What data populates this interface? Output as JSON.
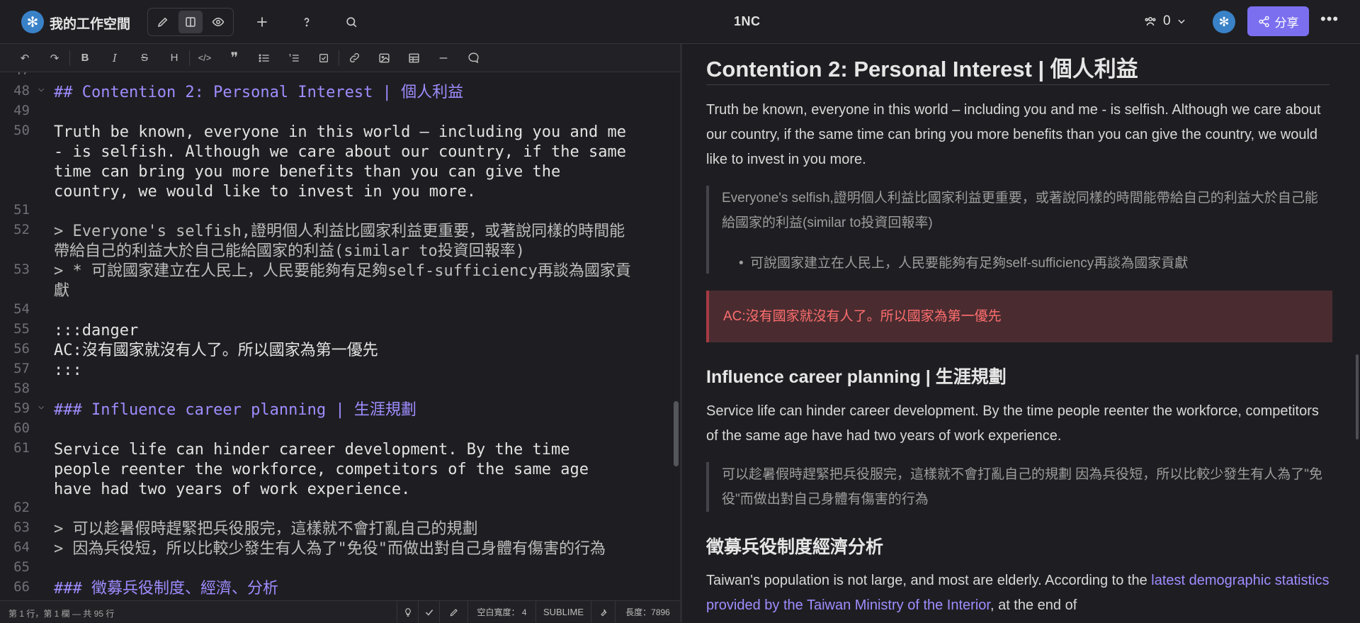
{
  "topbar": {
    "workspace": "我的工作空間",
    "title": "1NC",
    "online_count": "0",
    "share_label": "分享",
    "more_label": "•••"
  },
  "toolbar": {
    "heading_label": "H"
  },
  "editor": {
    "lines": [
      {
        "n": "48",
        "text": "## Contention 2: Personal Interest | 個人利益"
      },
      {
        "n": "49",
        "text": ""
      },
      {
        "n": "50",
        "text": "Truth be known, everyone in this world – including you and me\n- is selfish. Although we care about our country, if the same\ntime can bring you more benefits than you can give the\ncountry, we would like to invest in you more."
      },
      {
        "n": "51",
        "text": ""
      },
      {
        "n": "52",
        "text": "> Everyone's selfish,證明個人利益比國家利益更重要，或著說同樣的時間能\n帶給自己的利益大於自己能給國家的利益(similar to投資回報率)"
      },
      {
        "n": "53",
        "text": "> * 可說國家建立在人民上，人民要能夠有足夠self-sufficiency再談為國家貢\n獻"
      },
      {
        "n": "54",
        "text": ""
      },
      {
        "n": "55",
        "text": ":::danger"
      },
      {
        "n": "56",
        "text": "AC:沒有國家就沒有人了。所以國家為第一優先"
      },
      {
        "n": "57",
        "text": ":::"
      },
      {
        "n": "58",
        "text": ""
      },
      {
        "n": "59",
        "text": "### Influence career planning | 生涯規劃"
      },
      {
        "n": "60",
        "text": ""
      },
      {
        "n": "61",
        "text": "Service life can hinder career development. By the time\npeople reenter the workforce, competitors of the same age\nhave had two years of work experience."
      },
      {
        "n": "62",
        "text": ""
      },
      {
        "n": "63",
        "text": "> 可以趁暑假時趕緊把兵役服完，這樣就不會打亂自己的規劃"
      },
      {
        "n": "64",
        "text": "> 因為兵役短，所以比較少發生有人為了\"免役\"而做出對自己身體有傷害的行為"
      },
      {
        "n": "65",
        "text": ""
      },
      {
        "n": "66",
        "text": "### 徵募兵役制度、經濟、分析"
      }
    ]
  },
  "statusbar": {
    "position": "第 1 行，第 1 欄 — 共 95 行",
    "indent": "空白寬度： 4",
    "keymap": "SUBLIME",
    "length": "長度：7896"
  },
  "preview": {
    "h2": "Contention 2: Personal Interest | 個人利益",
    "p1": "Truth be known, everyone in this world – including you and me - is selfish. Although we care about our country, if the same time can bring you more benefits than you can give the country, we would like to invest in you more.",
    "quote1": "Everyone's selfish,證明個人利益比國家利益更重要，或著說同樣的時間能帶給自己的利益大於自己能給國家的利益(similar to投資回報率)",
    "quote1_li": "可說國家建立在人民上，人民要能夠有足夠self-sufficiency再談為國家貢獻",
    "danger": "AC:沒有國家就沒有人了。所以國家為第一優先",
    "h3_1": "Influence career planning | 生涯規劃",
    "p2": "Service life can hinder career development. By the time people reenter the workforce, competitors of the same age have had two years of work experience.",
    "quote2": "可以趁暑假時趕緊把兵役服完，這樣就不會打亂自己的規劃 因為兵役短，所以比較少發生有人為了\"免役\"而做出對自己身體有傷害的行為",
    "h3_2": "徵募兵役制度經濟分析",
    "p3_start": "Taiwan's population is not large, and most are elderly. According to the ",
    "p3_link": "latest demographic statistics provided by the Taiwan Ministry of the Interior",
    "p3_end": ", at the end of"
  }
}
